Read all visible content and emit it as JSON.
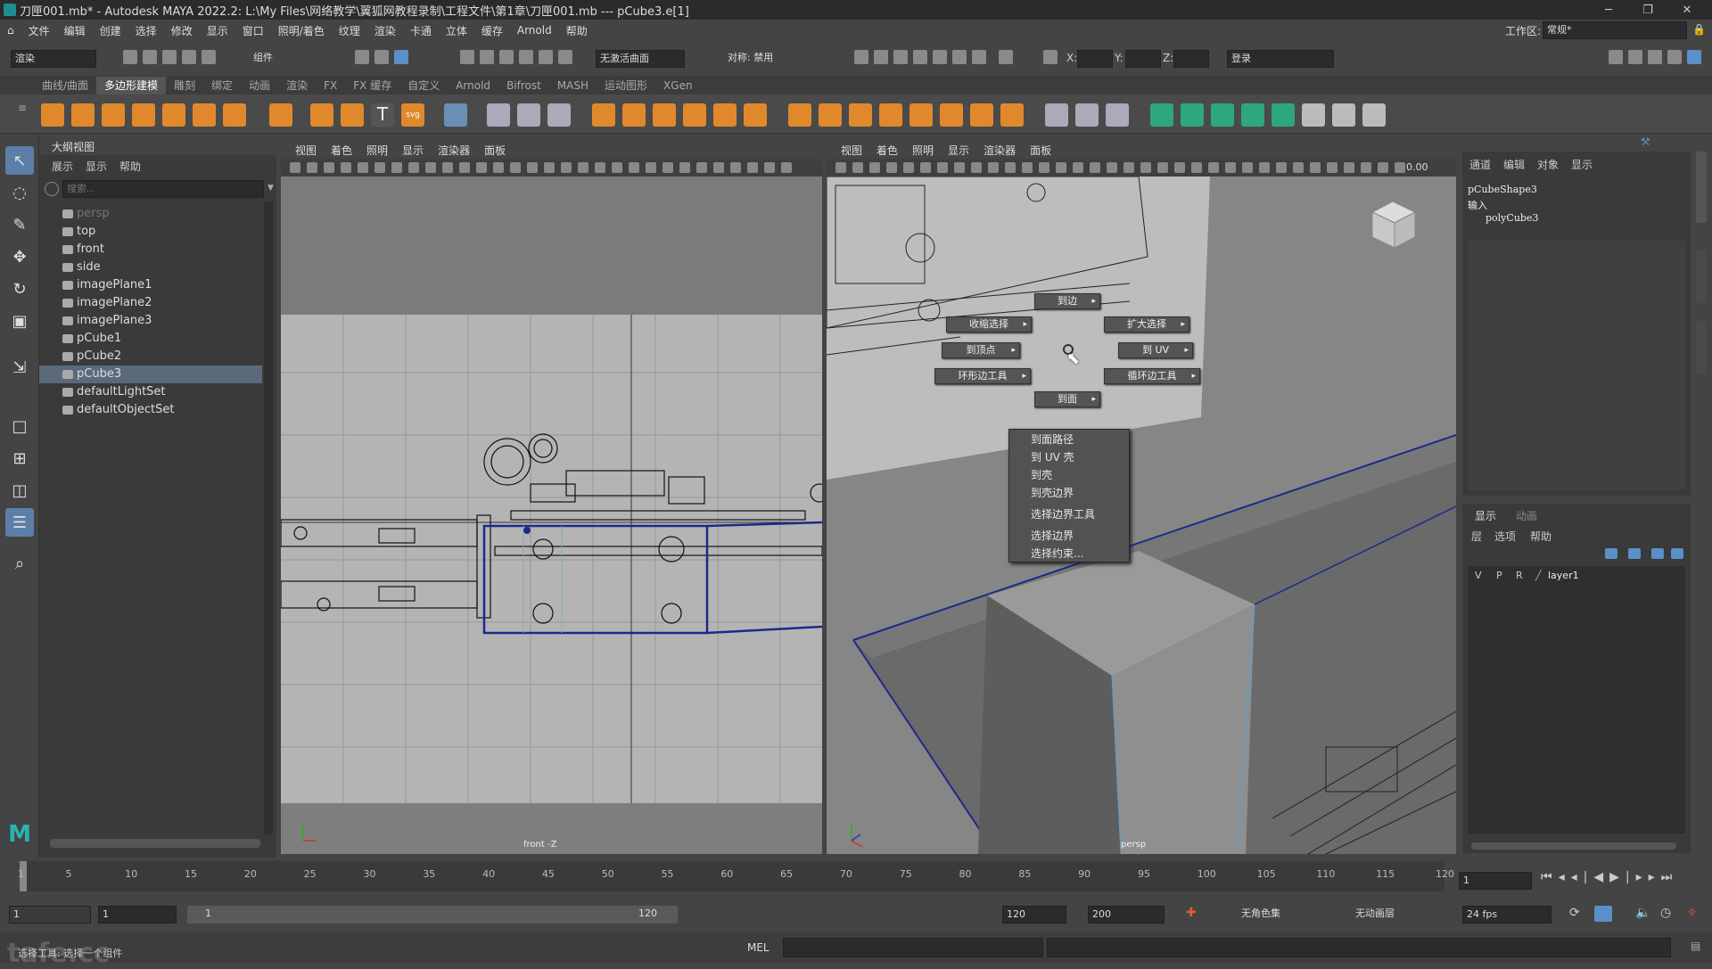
{
  "window": {
    "title": "刀匣001.mb* - Autodesk MAYA 2022.2: L:\\My Files\\网络教学\\翼狐网教程录制\\工程文件\\第1章\\刀匣001.mb   ---   pCube3.e[1]",
    "minimize": "─",
    "maximize": "❐",
    "close": "✕"
  },
  "menubar": [
    "文件",
    "编辑",
    "创建",
    "选择",
    "修改",
    "显示",
    "窗口",
    "照明/着色",
    "纹理",
    "渲染",
    "卡通",
    "立体",
    "缓存",
    "Arnold",
    "帮助"
  ],
  "workspace": {
    "label": "工作区:",
    "value": "常规*"
  },
  "toolbar": {
    "mode": "渲染",
    "component": "组件",
    "live_surface": "无激活曲面",
    "symmetry": "对称: 禁用",
    "x_label": "X:",
    "y_label": "Y:",
    "z_label": "Z:",
    "login": "登录"
  },
  "shelf_tabs": [
    "曲线/曲面",
    "多边形建模",
    "雕刻",
    "绑定",
    "动画",
    "渲染",
    "FX",
    "FX 缓存",
    "自定义",
    "Arnold",
    "Bifrost",
    "MASH",
    "运动图形",
    "XGen"
  ],
  "shelf_active": "多边形建模",
  "outliner": {
    "title": "大纲视图",
    "menus": [
      "展示",
      "显示",
      "帮助"
    ],
    "search_placeholder": "搜索...",
    "items": [
      {
        "label": "persp",
        "icon": "camera-icon",
        "dim": true
      },
      {
        "label": "top",
        "icon": "camera-icon"
      },
      {
        "label": "front",
        "icon": "camera-icon"
      },
      {
        "label": "side",
        "icon": "camera-icon"
      },
      {
        "label": "imagePlane1",
        "icon": "image-plane-icon"
      },
      {
        "label": "imagePlane2",
        "icon": "image-plane-icon"
      },
      {
        "label": "imagePlane3",
        "icon": "image-plane-icon"
      },
      {
        "label": "pCube1",
        "icon": "mesh-icon"
      },
      {
        "label": "pCube2",
        "icon": "mesh-icon"
      },
      {
        "label": "pCube3",
        "icon": "mesh-icon",
        "selected": true
      },
      {
        "label": "defaultLightSet",
        "icon": "set-icon"
      },
      {
        "label": "defaultObjectSet",
        "icon": "set-icon"
      }
    ]
  },
  "viewport_menu": [
    "视图",
    "着色",
    "照明",
    "显示",
    "渲染器",
    "面板"
  ],
  "viewport_left": {
    "camera": "front -Z"
  },
  "viewport_right": {
    "camera": "persp",
    "value": "0.00"
  },
  "marking_menu": {
    "to_edge": "到边",
    "shrink": "收缩选择",
    "grow": "扩大选择",
    "to_vertex": "到顶点",
    "to_uv": "到 UV",
    "ring_tool": "环形边工具",
    "loop_tool": "循环边工具",
    "to_face": "到面"
  },
  "context_menu": [
    "到面路径",
    "到 UV 壳",
    "到壳",
    "到壳边界",
    "选择边界工具",
    "选择边界",
    "选择约束..."
  ],
  "channel_box": {
    "menus": [
      "通道",
      "编辑",
      "对象",
      "显示"
    ],
    "shape": "pCubeShape3",
    "inputs_label": "输入",
    "input_node": "polyCube3"
  },
  "layer_editor": {
    "tabs": [
      "显示",
      "动画"
    ],
    "menus": [
      "层",
      "选项",
      "帮助"
    ],
    "layer": {
      "v": "V",
      "p": "P",
      "r": "R",
      "name": "layer1"
    }
  },
  "timeline": {
    "ticks": [
      "1",
      "5",
      "10",
      "15",
      "20",
      "25",
      "30",
      "35",
      "40",
      "45",
      "50",
      "55",
      "60",
      "65",
      "70",
      "75",
      "80",
      "85",
      "90",
      "95",
      "100",
      "105",
      "110",
      "115",
      "120"
    ],
    "current_frame": "1"
  },
  "range": {
    "start": "1",
    "playback_start": "1",
    "slider_start": "1",
    "slider_end": "120",
    "playback_end": "120",
    "end": "200",
    "character_set": "无角色集",
    "anim_layer": "无动画层",
    "fps": "24 fps"
  },
  "command": {
    "lang": "MEL",
    "help": "选择工具: 选择一个组件"
  },
  "watermark": "tafe.cc"
}
